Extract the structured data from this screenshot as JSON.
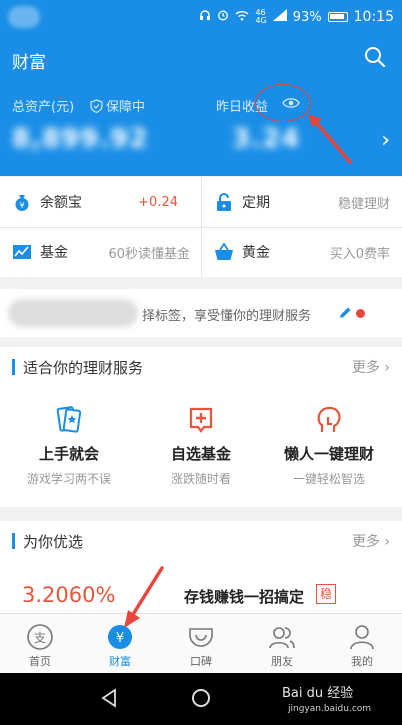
{
  "status_bar": {
    "battery": "93%",
    "time": "10:15",
    "signal": "4G",
    "speed": "46"
  },
  "header": {
    "title": "财富"
  },
  "assets": {
    "total_label": "总资产(元)",
    "guard_label": "保障中",
    "yesterday_label": "昨日收益",
    "total_value": "8,899.92",
    "yesterday_value": "3.24"
  },
  "products": [
    {
      "label": "余额宝",
      "value": "+0.24",
      "value_color": "#e8553c"
    },
    {
      "label": "定期",
      "value": "稳健理财",
      "value_color": "#999999"
    },
    {
      "label": "基金",
      "value": "60秒读懂基金",
      "value_color": "#999999"
    },
    {
      "label": "黄金",
      "value": "买入0费率",
      "value_color": "#999999"
    }
  ],
  "tag_bar": {
    "text": "择标签，享受懂你的理财服务"
  },
  "services": {
    "title": "适合你的理财服务",
    "more": "更多",
    "items": [
      {
        "title": "上手就会",
        "subtitle": "游戏学习两不误",
        "icon": "card-star-icon"
      },
      {
        "title": "自选基金",
        "subtitle": "涨跌随时看",
        "icon": "plus-box-icon"
      },
      {
        "title": "懒人一键理财",
        "subtitle": "一键轻松智选",
        "icon": "head-icon"
      }
    ]
  },
  "featured": {
    "title": "为你优选",
    "more": "更多",
    "rate": "3.2060%",
    "promo": "存钱赚钱一招搞定",
    "badge": "稳"
  },
  "tabs": [
    {
      "label": "首页",
      "icon": "home-icon",
      "active": false
    },
    {
      "label": "财富",
      "icon": "wealth-icon",
      "active": true
    },
    {
      "label": "口碑",
      "icon": "koubei-icon",
      "active": false
    },
    {
      "label": "朋友",
      "icon": "friends-icon",
      "active": false
    },
    {
      "label": "我的",
      "icon": "profile-icon",
      "active": false
    }
  ],
  "watermark": {
    "line1": "Bai du 经验",
    "line2": "jingyan.baidu.com"
  },
  "colors": {
    "primary_blue": "#1a8ee6",
    "accent_red": "#e8453c",
    "orange": "#e8553c"
  }
}
